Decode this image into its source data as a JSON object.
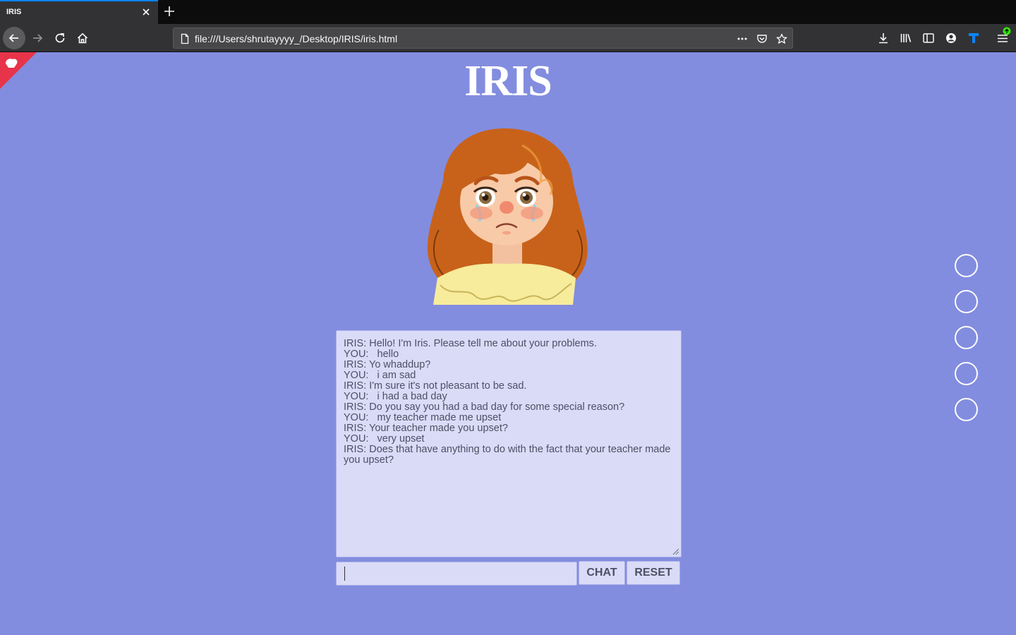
{
  "browser": {
    "tab_title": "IRIS",
    "url": "file:///Users/shrutayyyy_/Desktop/IRIS/iris.html",
    "accent_color": "#0a84ff"
  },
  "page": {
    "background_color": "#828ddf",
    "title": "IRIS",
    "avatar_icon": "sad-girl-avatar-illustration",
    "chat_log": [
      "IRIS: Hello! I'm Iris. Please tell me about your problems.",
      "YOU:   hello",
      "IRIS: Yo whaddup?",
      "YOU:   i am sad",
      "IRIS: I'm sure it's not pleasant to be sad.",
      "YOU:   i had a bad day",
      "IRIS: Do you say you had a bad day for some special reason?",
      "YOU:   my teacher made me upset",
      "IRIS: Your teacher made you upset?",
      "YOU:   very upset",
      "IRIS: Does that have anything to do with the fact that your teacher made you upset?"
    ],
    "input_value": "",
    "chat_button": "CHAT",
    "reset_button": "RESET",
    "side_nav_dots": 5
  }
}
